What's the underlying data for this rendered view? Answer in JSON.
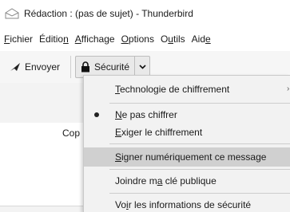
{
  "window": {
    "title": "Rédaction : (pas de sujet) - Thunderbird"
  },
  "menubar": {
    "items": [
      {
        "pre": "",
        "key": "F",
        "post": "ichier"
      },
      {
        "pre": "Éditio",
        "key": "n",
        "post": ""
      },
      {
        "pre": "",
        "key": "A",
        "post": "ffichage"
      },
      {
        "pre": "",
        "key": "O",
        "post": "ptions"
      },
      {
        "pre": "O",
        "key": "u",
        "post": "tils"
      },
      {
        "pre": "Aid",
        "key": "e",
        "post": ""
      }
    ]
  },
  "toolbar": {
    "send_label": "Envoyer",
    "security_label": "Sécurité"
  },
  "compose": {
    "partial_label": "Cop"
  },
  "security_menu": {
    "items": [
      {
        "pre": "",
        "key": "T",
        "post": "echnologie de chiffrement"
      },
      {
        "pre": "",
        "key": "N",
        "post": "e pas chiffrer"
      },
      {
        "pre": "",
        "key": "E",
        "post": "xiger le chiffrement"
      },
      {
        "pre": "",
        "key": "S",
        "post": "igner numériquement ce message"
      },
      {
        "pre": "Joindre m",
        "key": "a",
        "post": " clé publique"
      },
      {
        "pre": "Vo",
        "key": "i",
        "post": "r les informations de sécurité"
      }
    ],
    "checked_item": "Ne pas chiffrer",
    "highlighted_item": "Signer numériquement ce message"
  },
  "icons": {
    "app": "compose-window-icon",
    "send": "send-arrow-icon",
    "security": "lock-icon",
    "dropdown": "chevron-down-icon",
    "radio": "radio-bullet-icon",
    "submenu": "submenu-arrow-icon"
  }
}
